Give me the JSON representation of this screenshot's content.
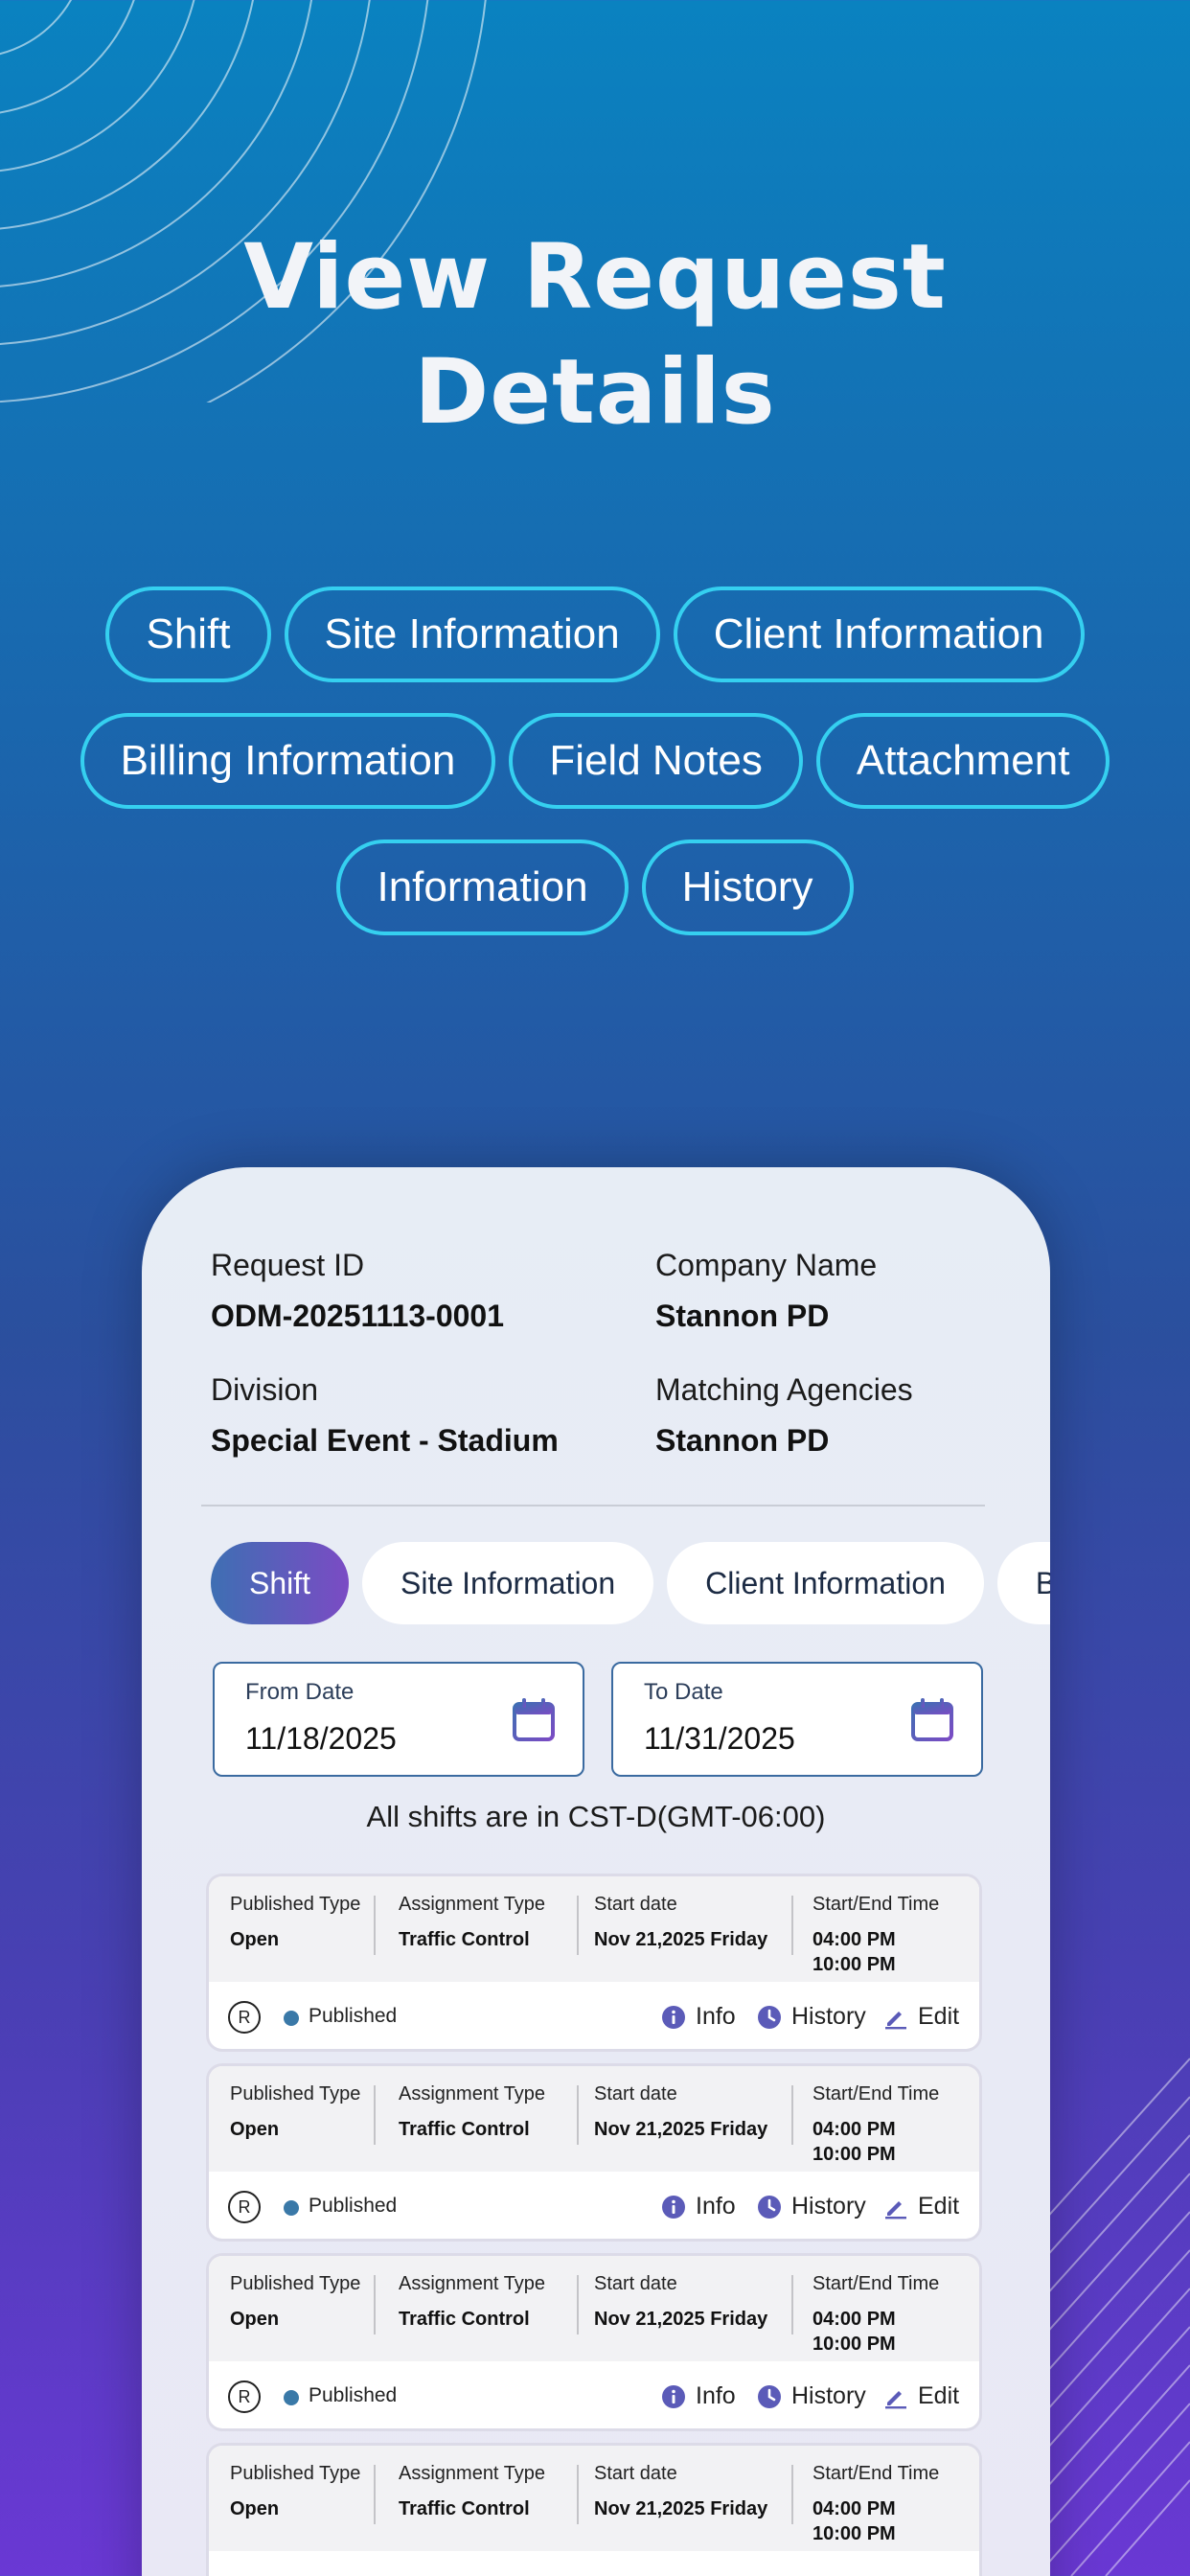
{
  "hero": {
    "line1": "View Request",
    "line2": "Details"
  },
  "features": [
    "Shift",
    "Site Information",
    "Client Information",
    "Billing Information",
    "Field Notes",
    "Attachment",
    "Information",
    "History"
  ],
  "request": {
    "id_label": "Request ID",
    "id_value": "ODM-20251113-0001",
    "company_label": "Company Name",
    "company_value": "Stannon PD",
    "division_label": "Division",
    "division_value": "Special Event - Stadium",
    "agencies_label": "Matching Agencies",
    "agencies_value": "Stannon PD"
  },
  "tabs": [
    "Shift",
    "Site Information",
    "Client Information",
    "B"
  ],
  "dates": {
    "from_label": "From Date",
    "from_value": "11/18/2025",
    "to_label": "To Date",
    "to_value": "11/31/2025"
  },
  "timezone_note": "All shifts are in CST-D(GMT-06:00)",
  "shift_headers": {
    "published_type": "Published Type",
    "assignment_type": "Assignment Type",
    "start_date": "Start date",
    "start_end_time": "Start/End Time"
  },
  "shifts": [
    {
      "published_type": "Open",
      "assignment_type": "Traffic Control",
      "start_date": "Nov 21,2025 Friday",
      "start_time": "04:00 PM",
      "end_time": "10:00 PM",
      "badge": "R",
      "status": "Published",
      "info": "Info",
      "history": "History",
      "edit": "Edit"
    },
    {
      "published_type": "Open",
      "assignment_type": "Traffic Control",
      "start_date": "Nov 21,2025 Friday",
      "start_time": "04:00 PM",
      "end_time": "10:00 PM",
      "badge": "R",
      "status": "Published",
      "info": "Info",
      "history": "History",
      "edit": "Edit"
    },
    {
      "published_type": "Open",
      "assignment_type": "Traffic Control",
      "start_date": "Nov 21,2025 Friday",
      "start_time": "04:00 PM",
      "end_time": "10:00 PM",
      "badge": "R",
      "status": "Published",
      "info": "Info",
      "history": "History",
      "edit": "Edit"
    },
    {
      "published_type": "Open",
      "assignment_type": "Traffic Control",
      "start_date": "Nov 21,2025 Friday",
      "start_time": "04:00 PM",
      "end_time": "10:00 PM"
    }
  ],
  "colors": {
    "chip_border": "#35d0f0",
    "accent_start": "#3e6fb3",
    "accent_end": "#7b4bc4",
    "status_dot": "#3a79a8",
    "icon": "#5b5bb8"
  },
  "icons": {
    "calendar": "calendar-icon",
    "info": "info-icon",
    "history": "clock-icon",
    "edit": "pencil-icon"
  }
}
